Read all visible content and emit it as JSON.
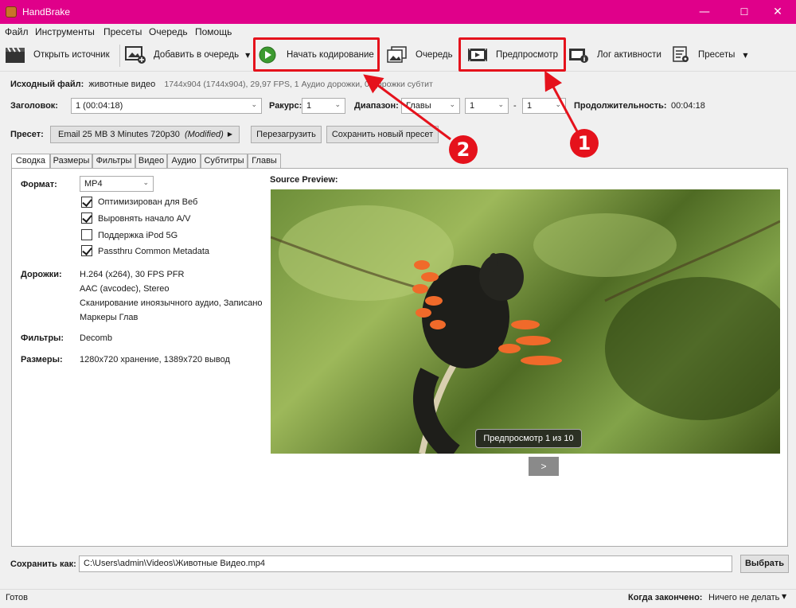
{
  "window": {
    "title": "HandBrake",
    "min": "—",
    "max": "☐",
    "close": "✕"
  },
  "menu": [
    "Файл",
    "Инструменты",
    "Пресеты",
    "Очередь",
    "Помощь"
  ],
  "toolbar": {
    "open_source": "Открыть источник",
    "add_queue": "Добавить в очередь",
    "start_encode": "Начать кодирование",
    "queue": "Очередь",
    "preview": "Предпросмотр",
    "activity_log": "Лог активности",
    "presets": "Пресеты"
  },
  "source": {
    "label": "Исходный файл:",
    "name": "животные видео",
    "info": "1744x904 (1744x904), 29,97 FPS, 1 Аудио дорожки, 0 Дорожки субтит"
  },
  "title_row": {
    "title_label": "Заголовок:",
    "title_value": "1  (00:04:18)",
    "angle_label": "Ракурс:",
    "angle_value": "1",
    "range_label": "Диапазон:",
    "range_type": "Главы",
    "range_from": "1",
    "range_dash": "-",
    "range_to": "1",
    "duration_label": "Продолжительность:",
    "duration_value": "00:04:18"
  },
  "preset_row": {
    "label": "Пресет:",
    "value": "Email 25 MB 3 Minutes 720p30",
    "modified": "(Modified)",
    "reload": "Перезагрузить",
    "save_new": "Сохранить новый пресет"
  },
  "tabs": [
    "Сводка",
    "Размеры",
    "Фильтры",
    "Видео",
    "Аудио",
    "Субтитры",
    "Главы"
  ],
  "summary": {
    "format_label": "Формат:",
    "format_value": "MP4",
    "opt_web": "Оптимизирован для Веб",
    "opt_web_checked": true,
    "align_av": "Выровнять начало A/V",
    "align_av_checked": true,
    "ipod": "Поддержка iPod 5G",
    "ipod_checked": false,
    "passthru": "Passthru Common Metadata",
    "passthru_checked": true,
    "tracks_label": "Дорожки:",
    "tracks": [
      "H.264 (x264), 30 FPS PFR",
      "AAC (avcodec), Stereo",
      "Сканирование иноязычного аудио, Записано",
      "Маркеры Глав"
    ],
    "filters_label": "Фильтры:",
    "filters_value": "Decomb",
    "sizes_label": "Размеры:",
    "sizes_value": "1280x720 хранение, 1389x720 вывод"
  },
  "preview": {
    "heading": "Source Preview:",
    "badge": "Предпросмотр 1 из 10",
    "next": ">"
  },
  "save_row": {
    "label": "Сохранить как:",
    "path": "C:\\Users\\admin\\Videos\\Животные Видео.mp4",
    "browse": "Выбрать"
  },
  "status": {
    "left": "Готов",
    "when_done_label": "Когда закончено:",
    "when_done_value": "Ничего не делать"
  },
  "callouts": {
    "one": "1",
    "two": "2"
  },
  "colors": {
    "titlebar": "#e0008a",
    "highlight": "#e5121c"
  }
}
